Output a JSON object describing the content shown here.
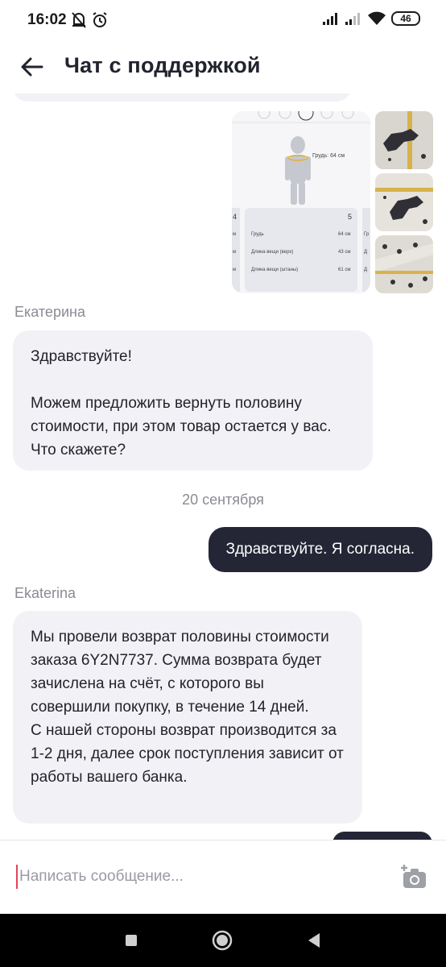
{
  "status": {
    "time": "16:02",
    "battery": "46"
  },
  "header": {
    "title": "Чат с поддержкой"
  },
  "size_card": {
    "chest_label": "Грудь: 64 см",
    "size_left": "4",
    "size_right": "5",
    "rows": [
      {
        "label": "Грудь",
        "value": "64 см"
      },
      {
        "label": "Длина вещи (верх)",
        "value": "43 см"
      },
      {
        "label": "Длина вещи (штаны)",
        "value": "61 см"
      }
    ],
    "left_suffix": "м",
    "right_prefix": [
      "Гр",
      "Д",
      "Д"
    ]
  },
  "messages": {
    "sender1": "Екатерина",
    "msg1": "Здравствуйте!\n\nМожем предложить вернуть половину стоимости, при этом товар остается у вас. Что скажете?",
    "date": "20 сентября",
    "reply": "Здравствуйте. Я согласна.",
    "sender2": "Ekaterina",
    "msg2": "Мы провели возврат половины стоимости заказа 6Y2N7737.  Сумма возврата будет зачислена на счёт, с которого вы совершили покупку, в течение 14 дней.\nС нашей стороны возврат производится за 1-2 дня, далее срок поступления зависит от работы вашего банка."
  },
  "composer": {
    "placeholder": "Написать сообщение..."
  },
  "icons": {
    "back": "arrow-left-icon",
    "camera": "camera-add-icon",
    "nav_square": "recent-apps-icon",
    "nav_circle": "home-icon",
    "nav_triangle": "back-nav-icon"
  }
}
